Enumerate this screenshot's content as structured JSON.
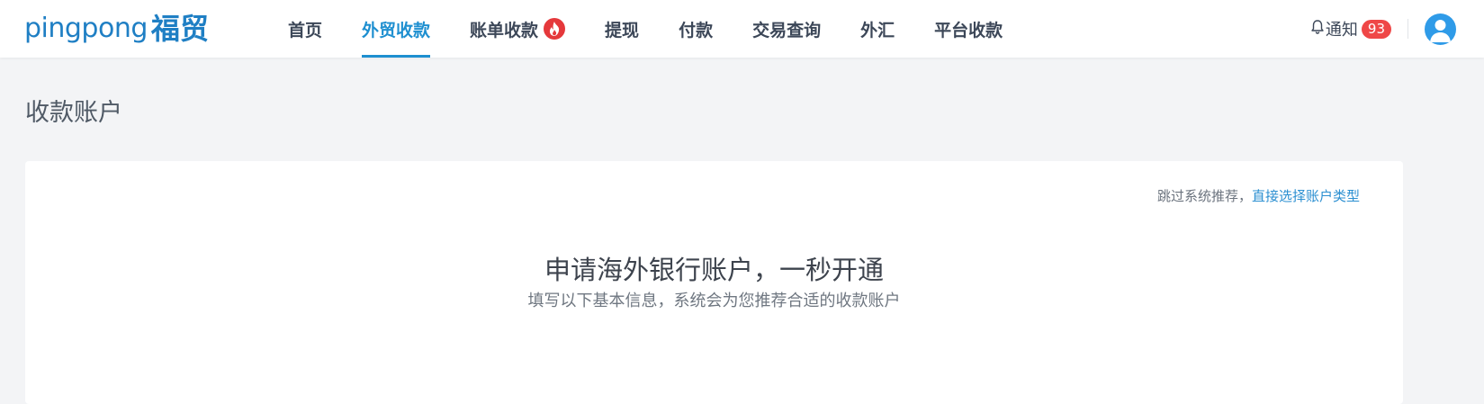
{
  "brand": {
    "latin": "pingpong",
    "cjk": "福贸",
    "color": "#1f7fc4"
  },
  "nav": {
    "items": [
      {
        "label": "首页"
      },
      {
        "label": "外贸收款",
        "active": true
      },
      {
        "label": "账单收款",
        "badge_icon": "fire-icon"
      },
      {
        "label": "提现"
      },
      {
        "label": "付款"
      },
      {
        "label": "交易查询"
      },
      {
        "label": "外汇"
      },
      {
        "label": "平台收款"
      }
    ],
    "accent": "#1e8fd0"
  },
  "header": {
    "notify_label": "通知",
    "notify_count": "93",
    "notify_icon": "bell-icon",
    "avatar_icon": "user-avatar-icon"
  },
  "page": {
    "title": "收款账户"
  },
  "card": {
    "skip_prefix": "跳过系统推荐，",
    "skip_link": "直接选择账户类型",
    "headline": "申请海外银行账户，一秒开通",
    "subline": "填写以下基本信息，系统会为您推荐合适的收款账户"
  }
}
